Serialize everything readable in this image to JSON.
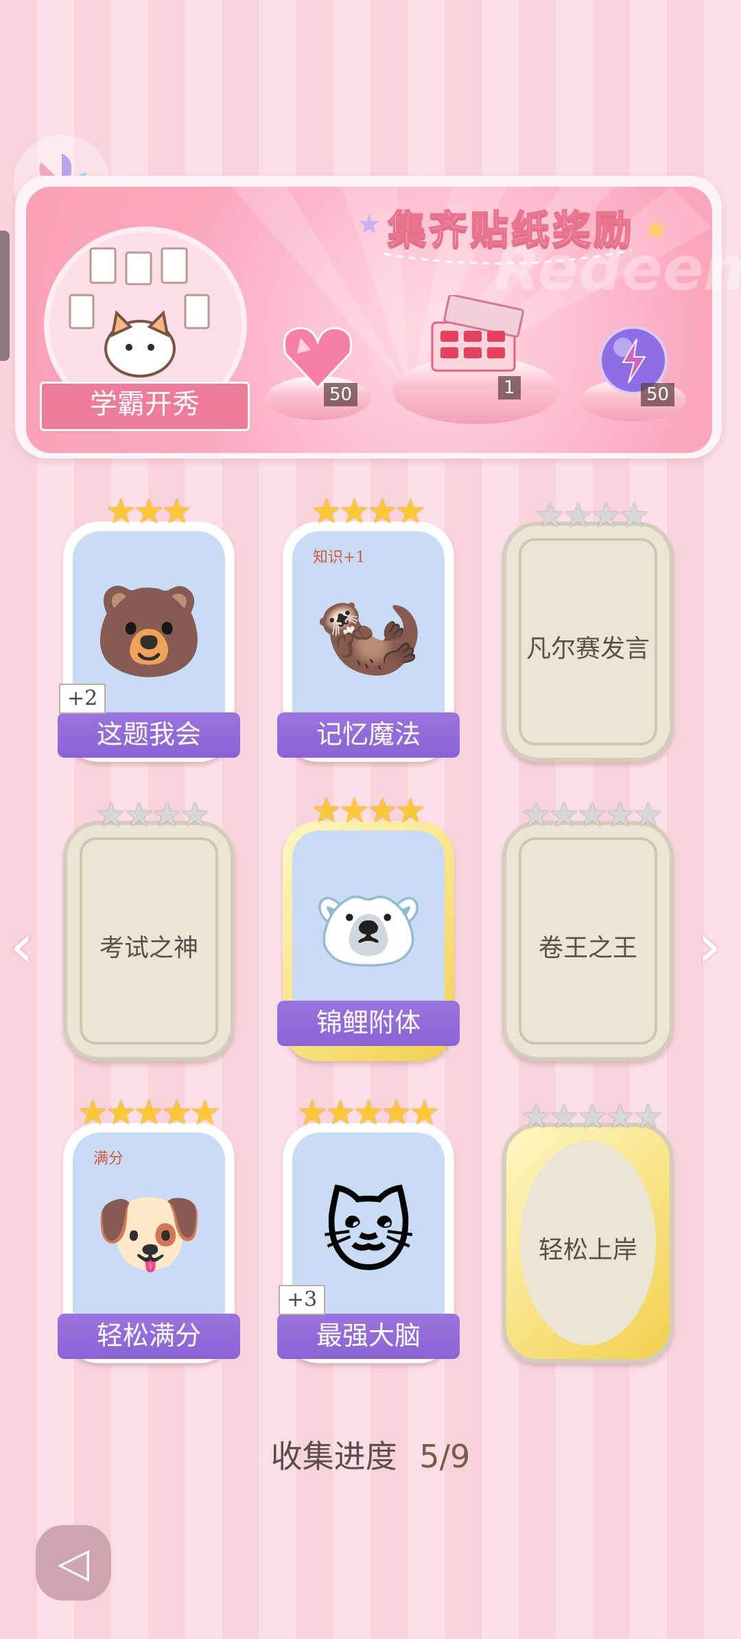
{
  "banner": {
    "title": "集齐贴纸奖励",
    "watermark": "Redeem",
    "feature_label": "学霸开秀",
    "rewards": [
      {
        "icon": "heart-gem-icon",
        "count": "50"
      },
      {
        "icon": "gift-box-icon",
        "count": "1"
      },
      {
        "icon": "lightning-orb-icon",
        "count": "50"
      }
    ]
  },
  "cards": [
    {
      "label": "这题我会",
      "unlocked": true,
      "stars_filled": 3,
      "stars_total": 3,
      "plus": "+2",
      "art": "bear-at-desk",
      "art_emoji": "🐻"
    },
    {
      "label": "记忆魔法",
      "unlocked": true,
      "stars_filled": 4,
      "stars_total": 4,
      "plus": "",
      "art": "wizard-otter",
      "art_emoji": "🦦",
      "art_text": "知识+1"
    },
    {
      "label": "凡尔赛发言",
      "unlocked": false,
      "stars_filled": 0,
      "stars_total": 4
    },
    {
      "label": "考试之神",
      "unlocked": false,
      "stars_filled": 0,
      "stars_total": 4
    },
    {
      "label": "锦鲤附体",
      "unlocked": true,
      "gold": true,
      "stars_filled": 4,
      "stars_total": 4,
      "plus": "",
      "art": "bear-with-koi",
      "art_emoji": "🐻‍❄️"
    },
    {
      "label": "卷王之王",
      "unlocked": false,
      "stars_filled": 0,
      "stars_total": 5
    },
    {
      "label": "轻松满分",
      "unlocked": true,
      "stars_filled": 5,
      "stars_total": 5,
      "plus": "",
      "art": "puppy-full-score",
      "art_emoji": "🐶",
      "art_text": "满分"
    },
    {
      "label": "最强大脑",
      "unlocked": true,
      "stars_filled": 5,
      "stars_total": 5,
      "plus": "+3",
      "art": "cat-with-papers",
      "art_emoji": "🐱"
    },
    {
      "label": "轻松上岸",
      "unlocked": false,
      "oval": true,
      "stars_filled": 0,
      "stars_total": 5
    }
  ],
  "progress": {
    "label": "收集进度",
    "value": "5/9"
  },
  "nav": {
    "prev": "‹",
    "next": "›"
  },
  "colors": {
    "card_label_purple": "#8a63d4",
    "banner_pink": "#f8a0b6",
    "star_gold": "#fcc936"
  }
}
